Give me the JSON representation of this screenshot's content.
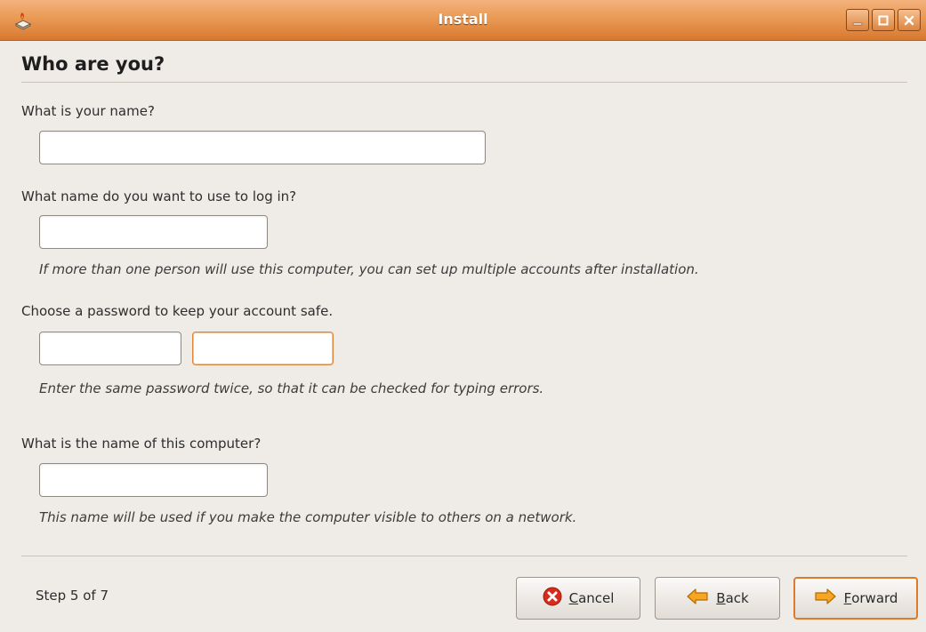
{
  "window": {
    "title": "Install",
    "icon": "installer-icon",
    "controls": [
      "minimize-icon",
      "maximize-icon",
      "close-icon"
    ]
  },
  "page": {
    "heading": "Who are you?"
  },
  "form": {
    "name_label": "What is your name?",
    "name_value": "",
    "login_label": "What name do you want to use to log in?",
    "login_value": "",
    "login_hint": "If more than one person will use this computer, you can set up multiple accounts after installation.",
    "password_label": "Choose a password to keep your account safe.",
    "password_value": "",
    "password_confirm_value": "",
    "password_hint": "Enter the same password twice, so that it can be checked for typing errors.",
    "computer_label": "What is the name of this computer?",
    "computer_value": "",
    "computer_hint": "This name will be used if you make the computer visible to others on a network."
  },
  "footer": {
    "step": "Step 5 of 7",
    "cancel": {
      "accel": "C",
      "rest": "ancel",
      "icon": "cancel-icon"
    },
    "back": {
      "accel": "B",
      "rest": "ack",
      "icon": "back-arrow-icon"
    },
    "forward": {
      "accel": "F",
      "rest": "orward",
      "icon": "forward-arrow-icon"
    }
  },
  "colors": {
    "titlebar": "#e99a55",
    "background": "#efebe7",
    "focus_accent": "#e07a2b"
  }
}
